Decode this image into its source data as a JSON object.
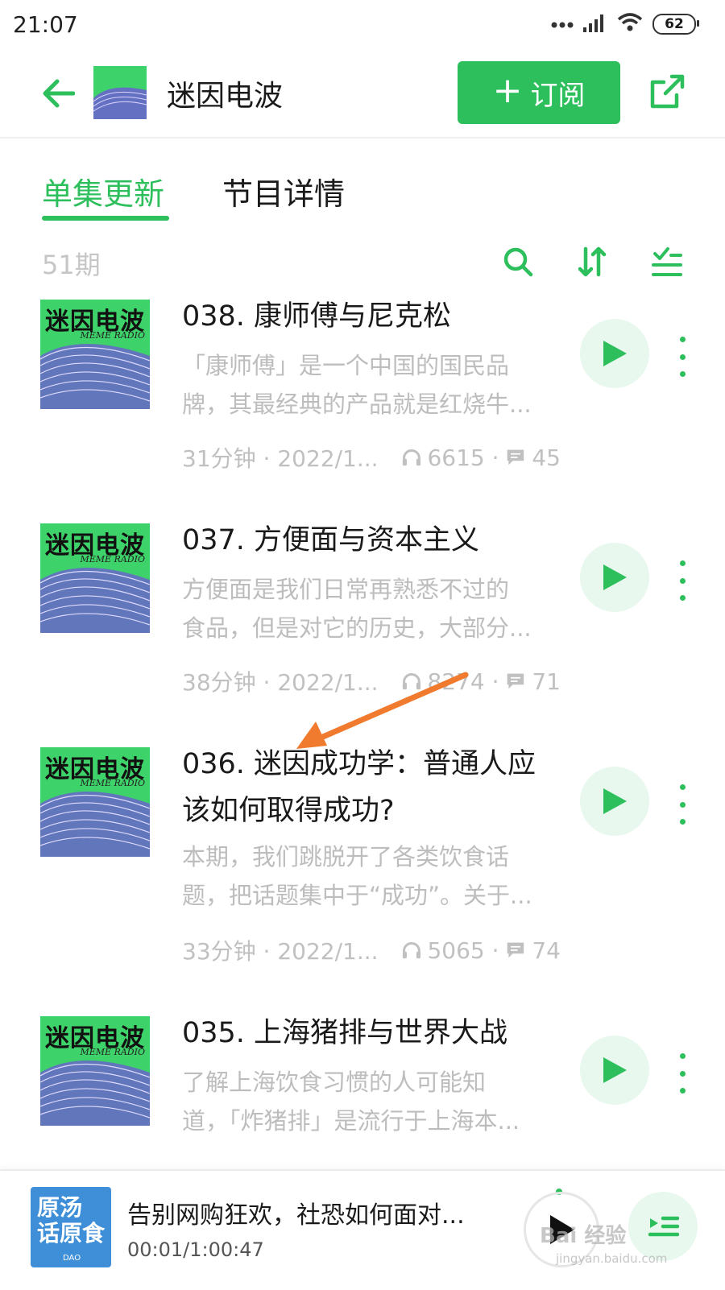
{
  "status_bar": {
    "time": "21:07",
    "battery": "62"
  },
  "header": {
    "title": "迷因电波",
    "subscribe_label": "订阅"
  },
  "tabs": [
    {
      "label": "单集更新",
      "active": true
    },
    {
      "label": "节目详情",
      "active": false
    }
  ],
  "toolbar": {
    "episode_count": "51期"
  },
  "cover": {
    "title": "迷因电波",
    "subtitle": "MEME RADIO"
  },
  "episodes": [
    {
      "title": "038. 康师傅与尼克松",
      "desc": [
        "「康师傅」是一个中国的国民品",
        "牌，其最经典的产品就是红烧牛..."
      ],
      "duration_date": "31分钟 · 2022/1...",
      "plays": "6615",
      "comments": "45"
    },
    {
      "title": "037. 方便面与资本主义",
      "desc": [
        "方便面是我们日常再熟悉不过的",
        "食品，但是对它的历史，大部分..."
      ],
      "duration_date": "38分钟 · 2022/1...",
      "plays": "8274",
      "comments": "71"
    },
    {
      "title": "036. 迷因成功学：普通人应该如何取得成功?",
      "desc": [
        "本期，我们跳脱开了各类饮食话",
        "题，把话题集中于“成功”。关于..."
      ],
      "duration_date": "33分钟 · 2022/1...",
      "plays": "5065",
      "comments": "74"
    },
    {
      "title": "035. 上海猪排与世界大战",
      "desc": [
        "了解上海饮食习惯的人可能知",
        "道，「炸猪排」是流行于上海本..."
      ],
      "duration_date": "",
      "plays": "",
      "comments": ""
    }
  ],
  "player": {
    "title": "告别网购狂欢，社恐如何面对...",
    "time": "00:01/1:00:47",
    "cover_text": [
      "原汤",
      "话原食"
    ],
    "cover_brand": "DAO"
  },
  "watermark": {
    "text": "Bai 经验",
    "sub": "jingyan.baidu.com"
  },
  "colors": {
    "accent": "#2dbf5c",
    "annotation_arrow": "#f07a2e"
  }
}
